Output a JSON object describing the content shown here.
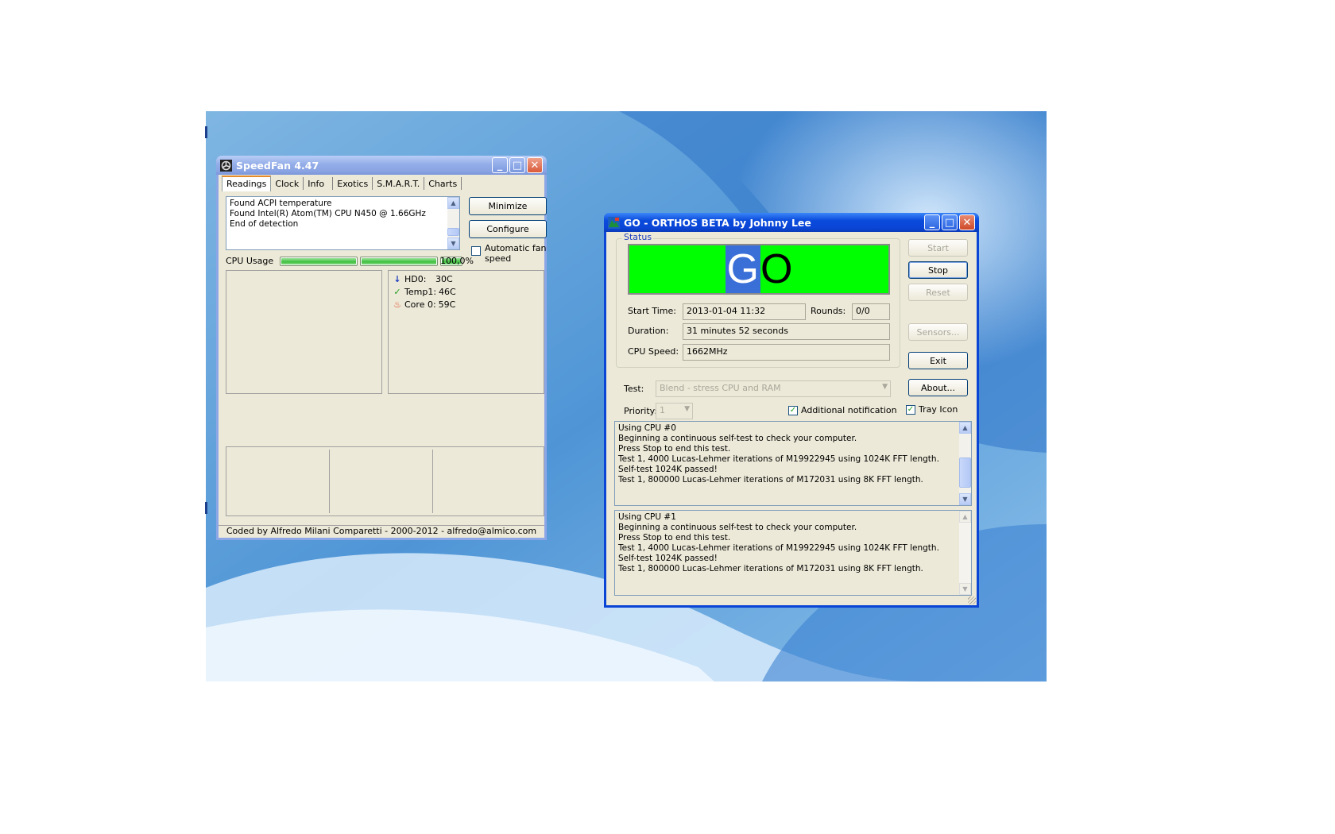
{
  "speedfan": {
    "title": "SpeedFan 4.47",
    "tabs": [
      "Readings",
      "Clock",
      "Info",
      "Exotics",
      "S.M.A.R.T.",
      "Charts"
    ],
    "log": "Found ACPI temperature\nFound Intel(R) Atom(TM) CPU N450 @ 1.66GHz\nEnd of detection",
    "minimize_label": "Minimize",
    "configure_label": "Configure",
    "auto_fan_label": "Automatic fan speed",
    "auto_fan_checked": false,
    "cpu_usage_label": "CPU Usage",
    "cpu_usage_value": "100,0%",
    "cpu_core_usage": [
      1.0,
      1.0,
      1.0
    ],
    "readings": [
      {
        "icon": "arrow-down-icon",
        "name": "HD0:",
        "value": "30C",
        "color": "#1c3fbf"
      },
      {
        "icon": "checkmark-icon",
        "name": "Temp1:",
        "value": "46C",
        "color": "#1f9d1f"
      },
      {
        "icon": "flame-icon",
        "name": "Core 0:",
        "value": "59C",
        "color": "#e2401c"
      }
    ],
    "footer": "Coded by Alfredo Milani Comparetti - 2000-2012 - alfredo@almico.com"
  },
  "orthos": {
    "title": "GO - ORTHOS BETA by Johnny Lee",
    "status_label": "Status",
    "status_text_g": "G",
    "status_text_o": "O",
    "status_color": "#00ff00",
    "start_time_label": "Start Time:",
    "start_time_value": "2013-01-04 11:32",
    "rounds_label": "Rounds:",
    "rounds_value": "0/0",
    "duration_label": "Duration:",
    "duration_value": "31 minutes 52 seconds",
    "cpu_speed_label": "CPU Speed:",
    "cpu_speed_value": "1662MHz",
    "test_label": "Test:",
    "test_value": "Blend - stress CPU and RAM",
    "priority_label": "Priority:",
    "priority_value": "1",
    "additional_notification_label": "Additional notification",
    "additional_notification_checked": true,
    "tray_icon_label": "Tray Icon",
    "tray_icon_checked": true,
    "buttons": {
      "start": "Start",
      "stop": "Stop",
      "reset": "Reset",
      "sensors": "Sensors...",
      "exit": "Exit",
      "about": "About..."
    },
    "log_cpu0": "Using CPU #0\nBeginning a continuous self-test to check your computer.\nPress Stop to end this test.\nTest 1, 4000 Lucas-Lehmer iterations of M19922945 using 1024K FFT length.\nSelf-test 1024K passed!\nTest 1, 800000 Lucas-Lehmer iterations of M172031 using 8K FFT length.",
    "log_cpu1": "Using CPU #1\nBeginning a continuous self-test to check your computer.\nPress Stop to end this test.\nTest 1, 4000 Lucas-Lehmer iterations of M19922945 using 1024K FFT length.\nSelf-test 1024K passed!\nTest 1, 800000 Lucas-Lehmer iterations of M172031 using 8K FFT length."
  },
  "colors": {
    "xp_title_active": "#0a45d6",
    "xp_title_inactive": "#8ca6e6",
    "window_bg": "#ece9d8",
    "go_highlight": "#3a6fd8"
  }
}
